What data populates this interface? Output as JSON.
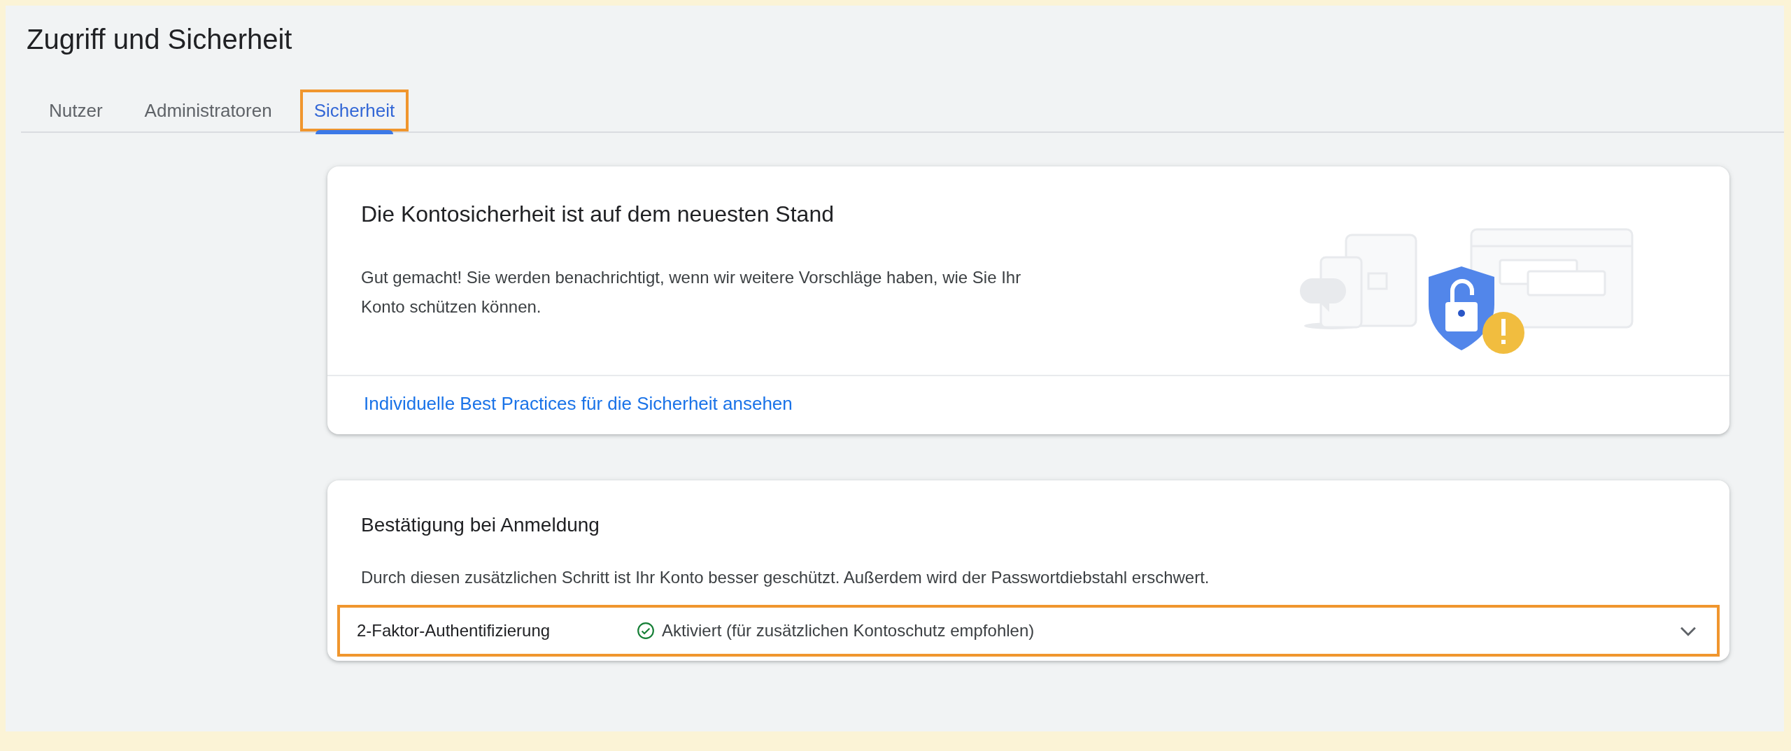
{
  "page": {
    "title": "Zugriff und Sicherheit"
  },
  "tabs": [
    {
      "label": "Nutzer",
      "selected": false,
      "highlighted": false
    },
    {
      "label": "Administratoren",
      "selected": false,
      "highlighted": false
    },
    {
      "label": "Sicherheit",
      "selected": true,
      "highlighted": true
    }
  ],
  "status_card": {
    "title": "Die Kontosicherheit ist auf dem neuesten Stand",
    "body": "Gut gemacht! Sie werden benachrichtigt, wenn wir weitere Vorschläge haben, wie Sie Ihr Konto schützen können.",
    "link": "Individuelle Best Practices für die Sicherheit ansehen"
  },
  "verification_card": {
    "title": "Bestätigung bei Anmeldung",
    "body": "Durch diesen zusätzlichen Schritt ist Ihr Konto besser geschützt. Außerdem wird der Passwortdiebstahl erschwert.",
    "rows": [
      {
        "label": "2-Faktor-Authentifizierung",
        "status": "Aktiviert (für zusätzlichen Kontoschutz empfohlen)",
        "active": true,
        "expanded": false,
        "highlighted": true
      }
    ]
  }
}
